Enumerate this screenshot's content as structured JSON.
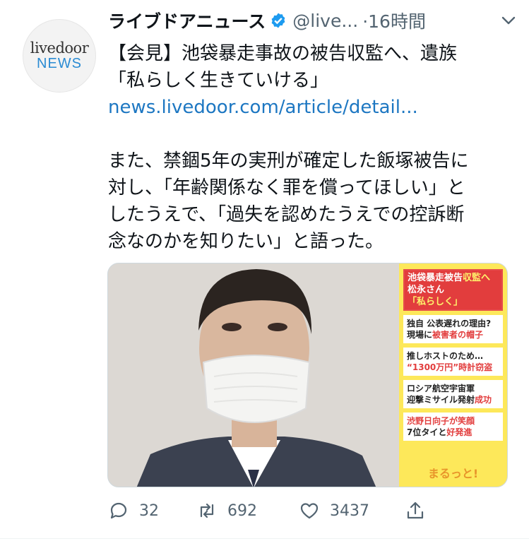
{
  "account": {
    "avatar_line1": "livedoor",
    "avatar_line2": "NEWS",
    "name": "ライブドアニュース",
    "handle": "@live...",
    "time": "·16時間"
  },
  "tweet": {
    "line1": "【会見】池袋暴走事故の被告収監へ、遺族",
    "line2": "「私らしく生きていける」",
    "link": "news.livedoor.com/article/detail...",
    "body": [
      "また、禁錮5年の実刑が確定した飯塚被告に",
      "対し、「年齢関係なく罪を償ってほしい」と",
      "したうえで、「過失を認めたうえでの控訴断",
      "念なのかを知りたい」と語った。"
    ]
  },
  "media_panel": {
    "head_a": "池袋暴走被告",
    "head_b": "収監へ",
    "head_c": "松永さん",
    "head_d": "「私らしく」",
    "items": [
      {
        "a": "独自 公表遅れの理由?",
        "b": "現場に",
        "c": "被害者の帽子"
      },
      {
        "a": "推しホストのため…",
        "b": "",
        "c": "“1300万円”時計窃盗"
      },
      {
        "a": "ロシア航空宇宙軍",
        "b": "迎撃ミサイル発射",
        "c": "成功"
      },
      {
        "a": "渋野日向子が笑顔",
        "b": "7位タイと",
        "c": "好発進"
      }
    ],
    "footer": "まるっと!"
  },
  "actions": {
    "replies": "32",
    "retweets": "692",
    "likes": "3437"
  },
  "colors": {
    "link": "#1d77c2",
    "verified": "#1d9bf0",
    "muted": "#536471"
  }
}
